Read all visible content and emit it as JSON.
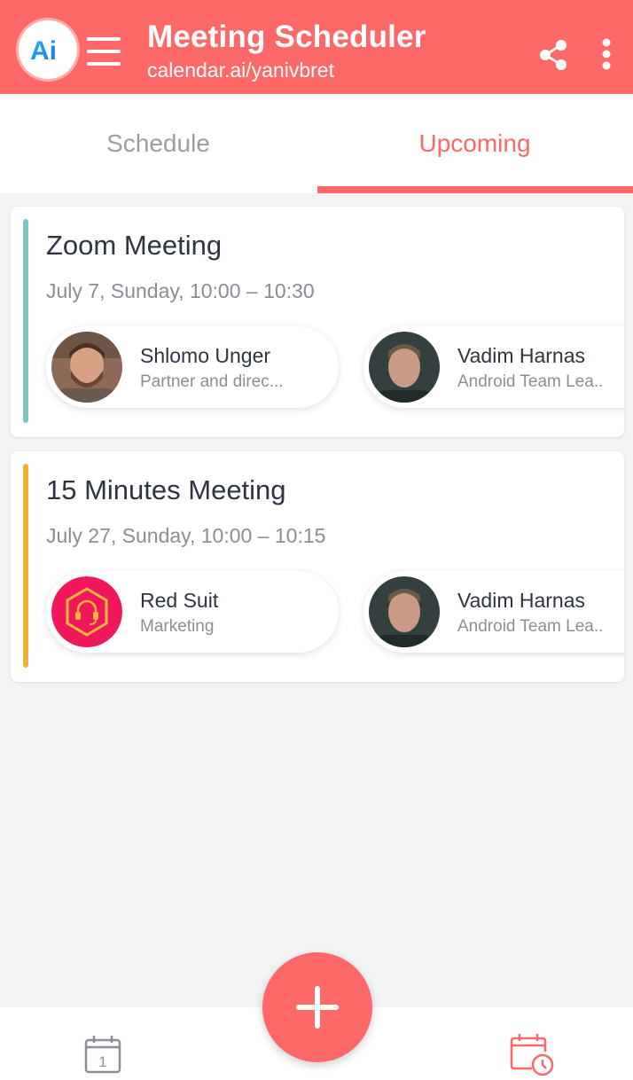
{
  "app": {
    "logo_text": "Ai",
    "title": "Meeting Scheduler",
    "subtitle": "calendar.ai/yanivbret",
    "accent_color": "#fd6868"
  },
  "header_icons": {
    "menu": "hamburger-menu-icon",
    "share": "share-icon",
    "more": "more-vertical-icon"
  },
  "tabs": [
    {
      "label": "Schedule",
      "active": false
    },
    {
      "label": "Upcoming",
      "active": true
    }
  ],
  "meetings": [
    {
      "title": "Zoom Meeting",
      "time": "July 7, Sunday, 10:00 – 10:30",
      "bar_color": "#7ec7c1",
      "participants": [
        {
          "name": "Shlomo Unger",
          "role": "Partner and direc..."
        },
        {
          "name": "Vadim Harnas",
          "role": "Android Team Lea.."
        }
      ]
    },
    {
      "title": "15 Minutes Meeting",
      "time": "July 27, Sunday, 10:00 – 10:15",
      "bar_color": "#f0b234",
      "participants": [
        {
          "name": "Red Suit",
          "role": "Marketing"
        },
        {
          "name": "Vadim Harnas",
          "role": "Android Team Lea.."
        }
      ]
    }
  ],
  "fab": {
    "icon": "plus-icon"
  },
  "bottom_nav": {
    "calendar_icon": "calendar-icon",
    "calendar_day": "1",
    "upcoming_icon": "calendar-clock-icon"
  }
}
